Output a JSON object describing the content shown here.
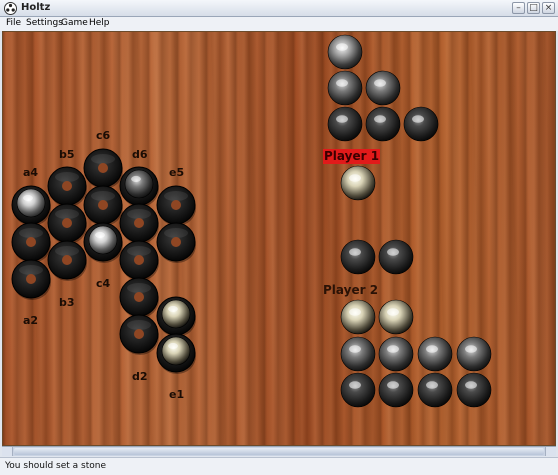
{
  "window": {
    "title": "Holtz",
    "icon": "app-icon"
  },
  "menu": {
    "items": [
      "File",
      "Settings",
      "Game",
      "Help"
    ]
  },
  "board": {
    "rings": [
      {
        "col": 0,
        "row": 0,
        "stone": "white"
      },
      {
        "col": 0,
        "row": 1,
        "stone": null
      },
      {
        "col": 0,
        "row": 2,
        "stone": null
      },
      {
        "col": 1,
        "row": 0,
        "stone": null
      },
      {
        "col": 1,
        "row": 1,
        "stone": null
      },
      {
        "col": 1,
        "row": 2,
        "stone": null
      },
      {
        "col": 2,
        "row": 0,
        "stone": null
      },
      {
        "col": 2,
        "row": 1,
        "stone": null
      },
      {
        "col": 2,
        "row": 2,
        "stone": "white"
      },
      {
        "col": 3,
        "row": 0,
        "stone": "gray"
      },
      {
        "col": 3,
        "row": 1,
        "stone": null
      },
      {
        "col": 3,
        "row": 2,
        "stone": null
      },
      {
        "col": 3,
        "row": 3,
        "stone": null
      },
      {
        "col": 3,
        "row": 4,
        "stone": null
      },
      {
        "col": 4,
        "row": 0,
        "stone": null
      },
      {
        "col": 4,
        "row": 1,
        "stone": null
      },
      {
        "col": 4,
        "row": 3,
        "stone": "cream"
      },
      {
        "col": 4,
        "row": 4,
        "stone": "cream"
      }
    ],
    "coords": [
      "a4",
      "a2",
      "b5",
      "b3",
      "c6",
      "c4",
      "d6",
      "d2",
      "e5",
      "e1"
    ]
  },
  "players": [
    {
      "label": "Player 1",
      "active": true,
      "reserve_stone": "cream",
      "captured": [
        "silver",
        "gray",
        "gray",
        "black",
        "black",
        "black"
      ]
    },
    {
      "label": "Player 2",
      "active": false,
      "reserve_stones": [
        "black",
        "black"
      ],
      "captured": [
        "cream",
        "cream",
        "gray",
        "gray",
        "gray",
        "gray",
        "black",
        "black",
        "black",
        "black"
      ]
    }
  ],
  "colors": {
    "active_player": "#e11a1a",
    "stone_white": "#f2f2f2",
    "stone_gray": "#9a9a9a",
    "stone_black": "#1a1a1a",
    "stone_cream": "#e8e2c8",
    "ring": "#141414",
    "wood": "#a8532a"
  },
  "status": {
    "message": "You should set a stone"
  }
}
